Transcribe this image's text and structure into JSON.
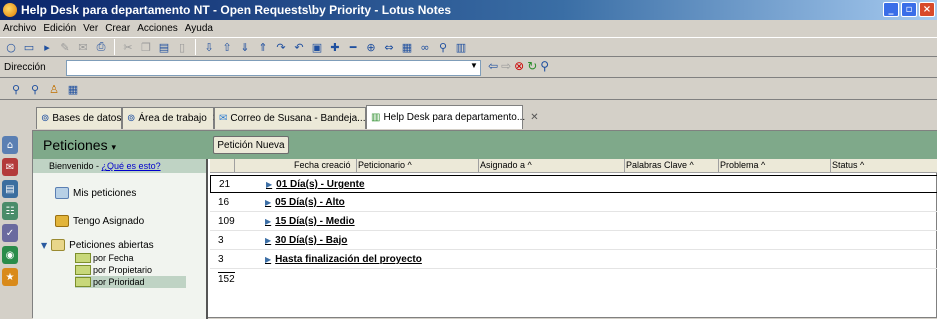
{
  "window": {
    "title": "Help Desk para departamento NT - Open Requests\\by Priority - Lotus Notes"
  },
  "menu": [
    "Archivo",
    "Edición",
    "Ver",
    "Crear",
    "Acciones",
    "Ayuda"
  ],
  "address": {
    "label": "Dirección",
    "value": ""
  },
  "tabs": [
    {
      "label": "Bases de datos"
    },
    {
      "label": "Área de trabajo"
    },
    {
      "label": "Correo de Susana - Bandeja..."
    },
    {
      "label": "Help Desk para departamento..."
    }
  ],
  "header": {
    "title": "Peticiones",
    "new_button": "Petición Nueva"
  },
  "sidebar": {
    "welcome_text": "Bienvenido - ",
    "welcome_link": "¿Qué es esto?",
    "items": [
      {
        "label": "Mis peticiones"
      },
      {
        "label": "Tengo Asignado"
      },
      {
        "label": "Peticiones abiertas"
      }
    ],
    "subitems": [
      {
        "label": "por Fecha"
      },
      {
        "label": "por Propietario"
      },
      {
        "label": "por Prioridad"
      }
    ]
  },
  "columns": [
    "Fecha creació",
    "Peticionario ^",
    "Asignado a ^",
    "Palabras Clave ^",
    "Problema ^",
    "Status ^"
  ],
  "rows": [
    {
      "count": "21",
      "category": "01 Día(s) - Urgente"
    },
    {
      "count": "16",
      "category": "05 Día(s) - Alto"
    },
    {
      "count": "109",
      "category": "15 Día(s) - Medio"
    },
    {
      "count": "3",
      "category": "30 Día(s) - Bajo"
    },
    {
      "count": "3",
      "category": "Hasta finalización del proyecto"
    }
  ],
  "total": "152",
  "colors": {
    "green_header": "#7fa98a",
    "sidebar_selected": "#bfd3c4",
    "titlebar": "#0a246a"
  }
}
